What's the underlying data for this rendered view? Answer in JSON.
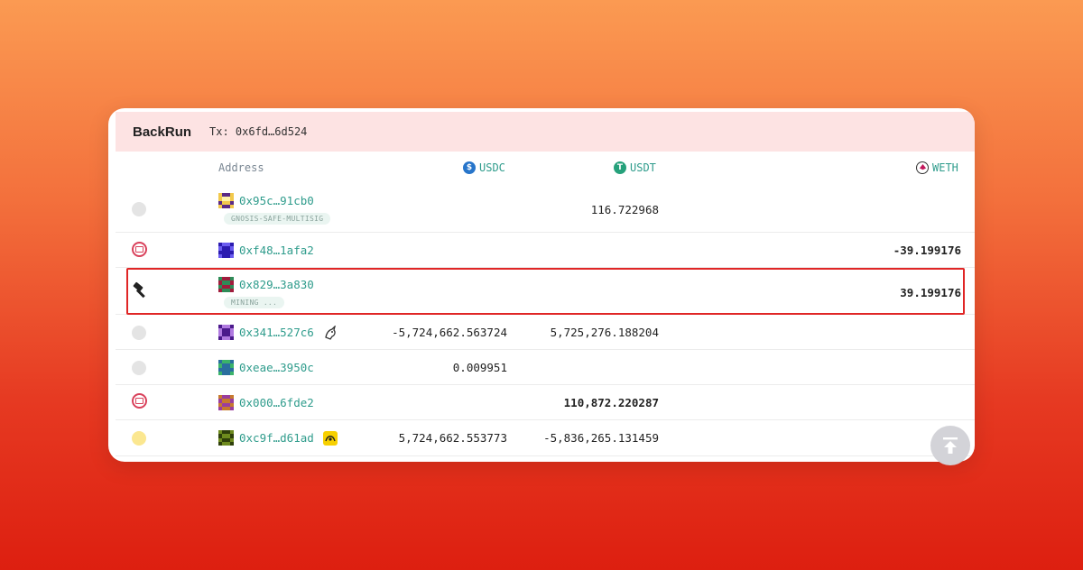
{
  "header": {
    "title": "BackRun",
    "tx": "Tx: 0x6fd…6d524"
  },
  "columns": {
    "address": "Address",
    "usdc": "USDC",
    "usdt": "USDT",
    "weth": "WETH"
  },
  "icons": {
    "usdc": "usdc-token-icon",
    "usdt": "usdt-token-icon",
    "weth": "weth-token-icon",
    "scroll_top": "arrow-up-to-top-icon"
  },
  "colors": {
    "address_text": "#2f9c8c",
    "highlight_border": "#e02626",
    "header_bg": "#fde3e3"
  },
  "rows": [
    {
      "icon": "gray-dot",
      "address": "0x95c…91cb0",
      "tag": "GNOSIS-SAFE-MULTISIG",
      "usdc": "",
      "usdt": "116.722968",
      "weth": ""
    },
    {
      "icon": "robot-icon",
      "address": "0xf48…1afa2",
      "tag": "",
      "usdc": "",
      "usdt": "",
      "weth": "-39.199176"
    },
    {
      "icon": "hammer-icon",
      "address": "0x829…3a830",
      "tag": "MINING ...",
      "usdc": "",
      "usdt": "",
      "weth": "39.199176"
    },
    {
      "icon": "gray-dot",
      "address": "0x341…527c6",
      "tag": "",
      "badge": "unicorn-icon",
      "usdc": "-5,724,662.563724",
      "usdt": "5,725,276.188204",
      "weth": ""
    },
    {
      "icon": "gray-dot",
      "address": "0xeae…3950c",
      "tag": "",
      "usdc": "0.009951",
      "usdt": "",
      "weth": ""
    },
    {
      "icon": "robot-icon",
      "address": "0x000…6fde2",
      "tag": "",
      "usdc": "",
      "usdt": "110,872.220287",
      "weth": ""
    },
    {
      "icon": "yellow-dot",
      "address": "0xc9f…d61ad",
      "tag": "",
      "badge": "curve-icon",
      "usdc": "5,724,662.553773",
      "usdt": "-5,836,265.131459",
      "weth": ""
    }
  ]
}
